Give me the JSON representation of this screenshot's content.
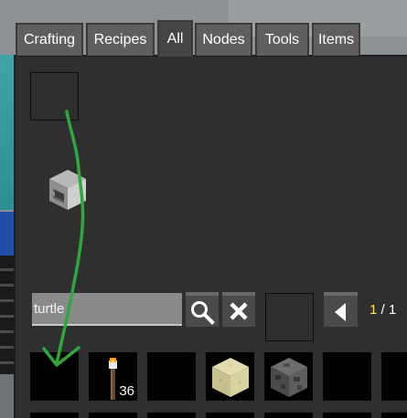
{
  "tabs": [
    {
      "label": "Crafting",
      "active": false
    },
    {
      "label": "Recipes",
      "active": false
    },
    {
      "label": "All",
      "active": true
    },
    {
      "label": "Nodes",
      "active": false
    },
    {
      "label": "Tools",
      "active": false
    },
    {
      "label": "Items",
      "active": false
    }
  ],
  "search": {
    "value": "turtle",
    "search_icon": "magnifier-icon",
    "clear_icon": "x-icon"
  },
  "pagination": {
    "current": "1",
    "separator": " / ",
    "total": "1",
    "prev_icon": "left-arrow-icon"
  },
  "preview": {
    "item_icon": "turtle-block-icon"
  },
  "items": [
    {
      "name": "empty",
      "count": ""
    },
    {
      "name": "torch",
      "icon": "torch-icon",
      "count": "36"
    },
    {
      "name": "empty",
      "count": ""
    },
    {
      "name": "sandstone",
      "icon": "sandstone-block-icon",
      "count": ""
    },
    {
      "name": "cobblestone",
      "icon": "cobblestone-block-icon",
      "count": ""
    },
    {
      "name": "empty",
      "count": ""
    },
    {
      "name": "empty",
      "count": ""
    }
  ],
  "colors": {
    "panel": "#2f2f2f",
    "tab_active": "#454545",
    "tab_inactive": "#5f5f5f",
    "page_current": "#ffe34a",
    "annotation_arrow": "#2ea83a"
  }
}
